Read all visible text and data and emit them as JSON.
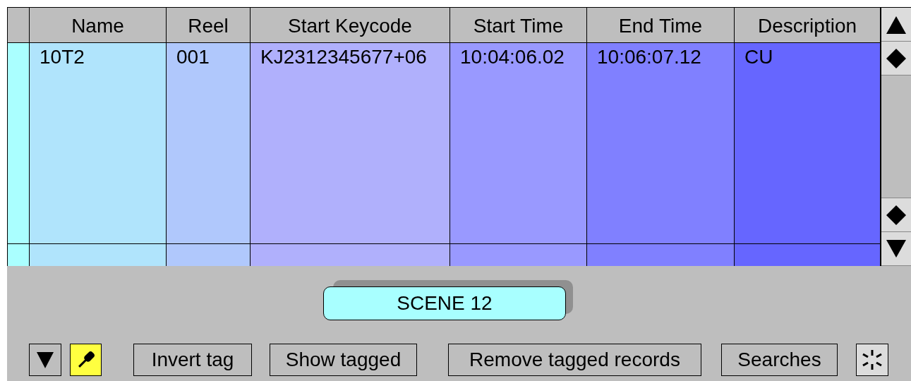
{
  "table": {
    "columns": [
      "Name",
      "Reel",
      "Start Keycode",
      "Start Time",
      "End Time",
      "Description"
    ],
    "rows": [
      {
        "cells": [
          "10T2",
          "001",
          "KJ2312345677+06",
          "10:04:06.02",
          "10:06:07.12",
          "CU"
        ]
      }
    ]
  },
  "scene_tab": {
    "label": "SCENE 12"
  },
  "buttons": [
    "Invert tag",
    "Show tagged",
    "Remove tagged records",
    "Searches"
  ]
}
